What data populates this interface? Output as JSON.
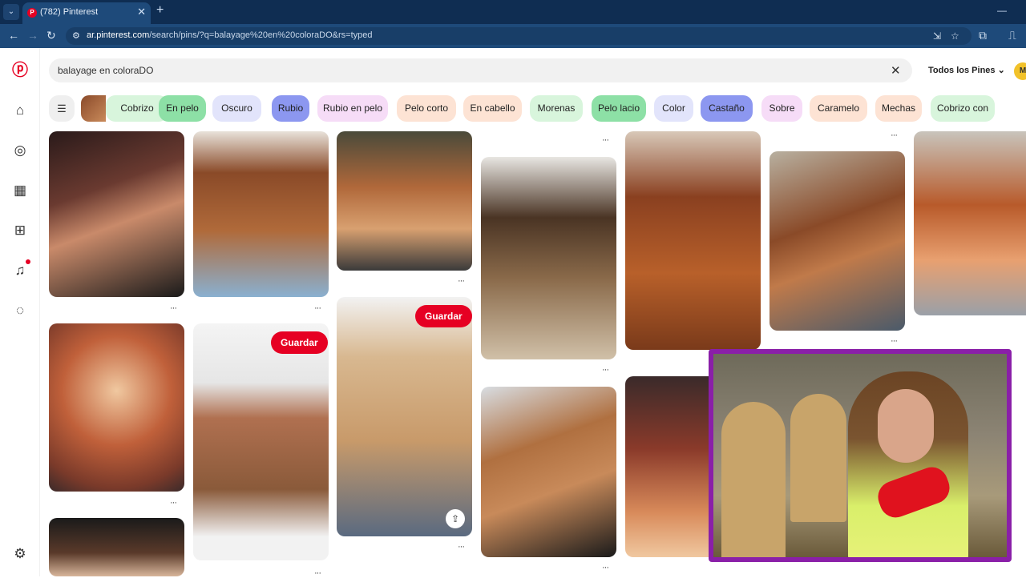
{
  "browser": {
    "tab_title": "(782) Pinterest",
    "tab_favicon": "P",
    "url_host": "ar.pinterest.com",
    "url_path": "/search/pins/?q=balayage%20en%20coloraDO&rs=typed"
  },
  "search": {
    "value": "balayage en coloraDO",
    "filter": "Todos los Pines",
    "avatar_initial": "M"
  },
  "chips": [
    {
      "label": "Cobrizo",
      "bg": "#d8f5dc"
    },
    {
      "label": "En pelo",
      "bg": "#8de0a6"
    },
    {
      "label": "Oscuro",
      "bg": "#e2e4fb"
    },
    {
      "label": "Rubio",
      "bg": "#8c97f0"
    },
    {
      "label": "Rubio en pelo",
      "bg": "#f6dcf7"
    },
    {
      "label": "Pelo corto",
      "bg": "#fde3d4"
    },
    {
      "label": "En cabello",
      "bg": "#fde3d4"
    },
    {
      "label": "Morenas",
      "bg": "#d8f5dc"
    },
    {
      "label": "Pelo lacio",
      "bg": "#8de0a6"
    },
    {
      "label": "Color",
      "bg": "#e2e4fb"
    },
    {
      "label": "Castaño",
      "bg": "#8c97f0"
    },
    {
      "label": "Sobre",
      "bg": "#f6dcf7"
    },
    {
      "label": "Caramelo",
      "bg": "#fde3d4"
    },
    {
      "label": "Mechas",
      "bg": "#fde3d4"
    },
    {
      "label": "Cobrizo con",
      "bg": "#d8f5dc"
    }
  ],
  "pins": {
    "save_label": "Guardar",
    "more_label": "···"
  },
  "colors": {
    "brand": "#e60023",
    "webcam_border": "#8a1fa8"
  }
}
